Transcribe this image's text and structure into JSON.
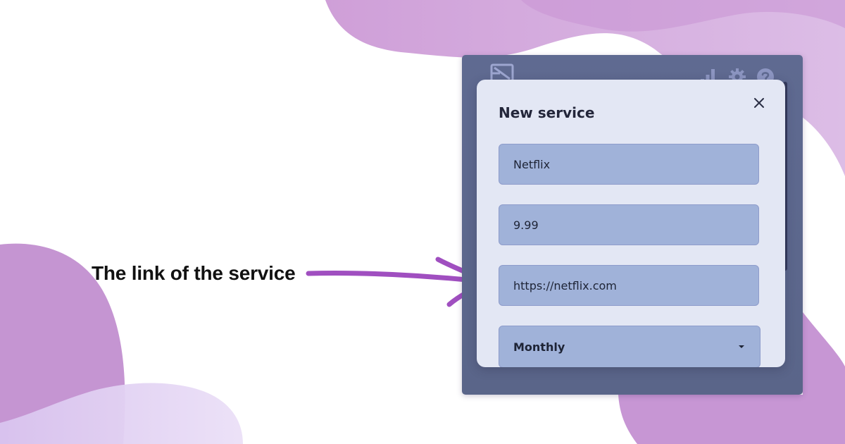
{
  "annotation": {
    "caption": "The link of the service"
  },
  "modal": {
    "title": "New service",
    "fields": {
      "name": "Netflix",
      "price": "9.99",
      "url": "https://netflix.com"
    },
    "billing_cycle": "Monthly"
  },
  "icons": {
    "logo": "app-logo-icon",
    "stats": "bar-chart-icon",
    "settings": "gear-icon",
    "help": "help-icon",
    "close": "close-icon",
    "dropdown": "caret-down-icon"
  },
  "colors": {
    "accent_purple": "#a04fc0",
    "blob_purple": "#c89ad6",
    "window_bg": "#5f6a91",
    "modal_bg": "#e3e7f4",
    "field_bg": "#a0b2d9"
  }
}
